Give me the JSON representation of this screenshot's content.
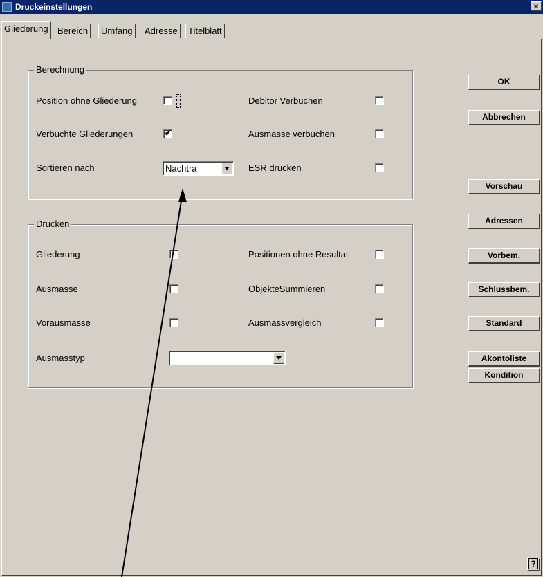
{
  "window": {
    "title": "Druckeinstellungen",
    "close_glyph": "×",
    "app_icon": "app-icon"
  },
  "tabs": [
    {
      "label": "Gliederung",
      "active": true
    },
    {
      "label": "Bereich",
      "active": false
    },
    {
      "label": "Umfang",
      "active": false
    },
    {
      "label": "Adresse",
      "active": false
    },
    {
      "label": "Titelblatt",
      "active": false
    }
  ],
  "berechnung": {
    "title": "Berechnung",
    "position_ohne_gliederung": {
      "label": "Position ohne Gliederung",
      "checked": false
    },
    "verbuchte_gliederungen": {
      "label": "Verbuchte Gliederungen",
      "checked": true
    },
    "sortieren_nach": {
      "label": "Sortieren nach",
      "value": "Nachtra"
    },
    "debitor_verbuchen": {
      "label": "Debitor Verbuchen",
      "checked": false
    },
    "ausmasse_verbuchen": {
      "label": "Ausmasse verbuchen",
      "checked": false
    },
    "esr_drucken": {
      "label": "ESR drucken",
      "checked": false
    }
  },
  "drucken": {
    "title": "Drucken",
    "gliederung": {
      "label": "Gliederung",
      "checked": false
    },
    "ausmasse": {
      "label": "Ausmasse",
      "checked": false
    },
    "vorausmasse": {
      "label": "Vorausmasse",
      "checked": false
    },
    "ausmasstyp": {
      "label": "Ausmasstyp",
      "value": ""
    },
    "positionen_ohne_resultat": {
      "label": "Positionen ohne Resultat",
      "checked": false
    },
    "objekte_summieren": {
      "label": "ObjekteSummieren",
      "checked": false
    },
    "ausmassvergleich": {
      "label": "Ausmassvergleich",
      "checked": false
    }
  },
  "buttons": {
    "ok": "OK",
    "abbrechen": "Abbrechen",
    "vorschau": "Vorschau",
    "adressen": "Adressen",
    "vorbem": "Vorbem.",
    "schlussbem": "Schlussbem.",
    "standard": "Standard",
    "akontoliste": "Akontoliste",
    "kondition": "Kondition",
    "help": "?"
  },
  "checkmark_glyph": "✔",
  "colors": {
    "titlebar": "#0a246a",
    "face": "#d4d0c8",
    "annotation_arrow": "#000000"
  }
}
